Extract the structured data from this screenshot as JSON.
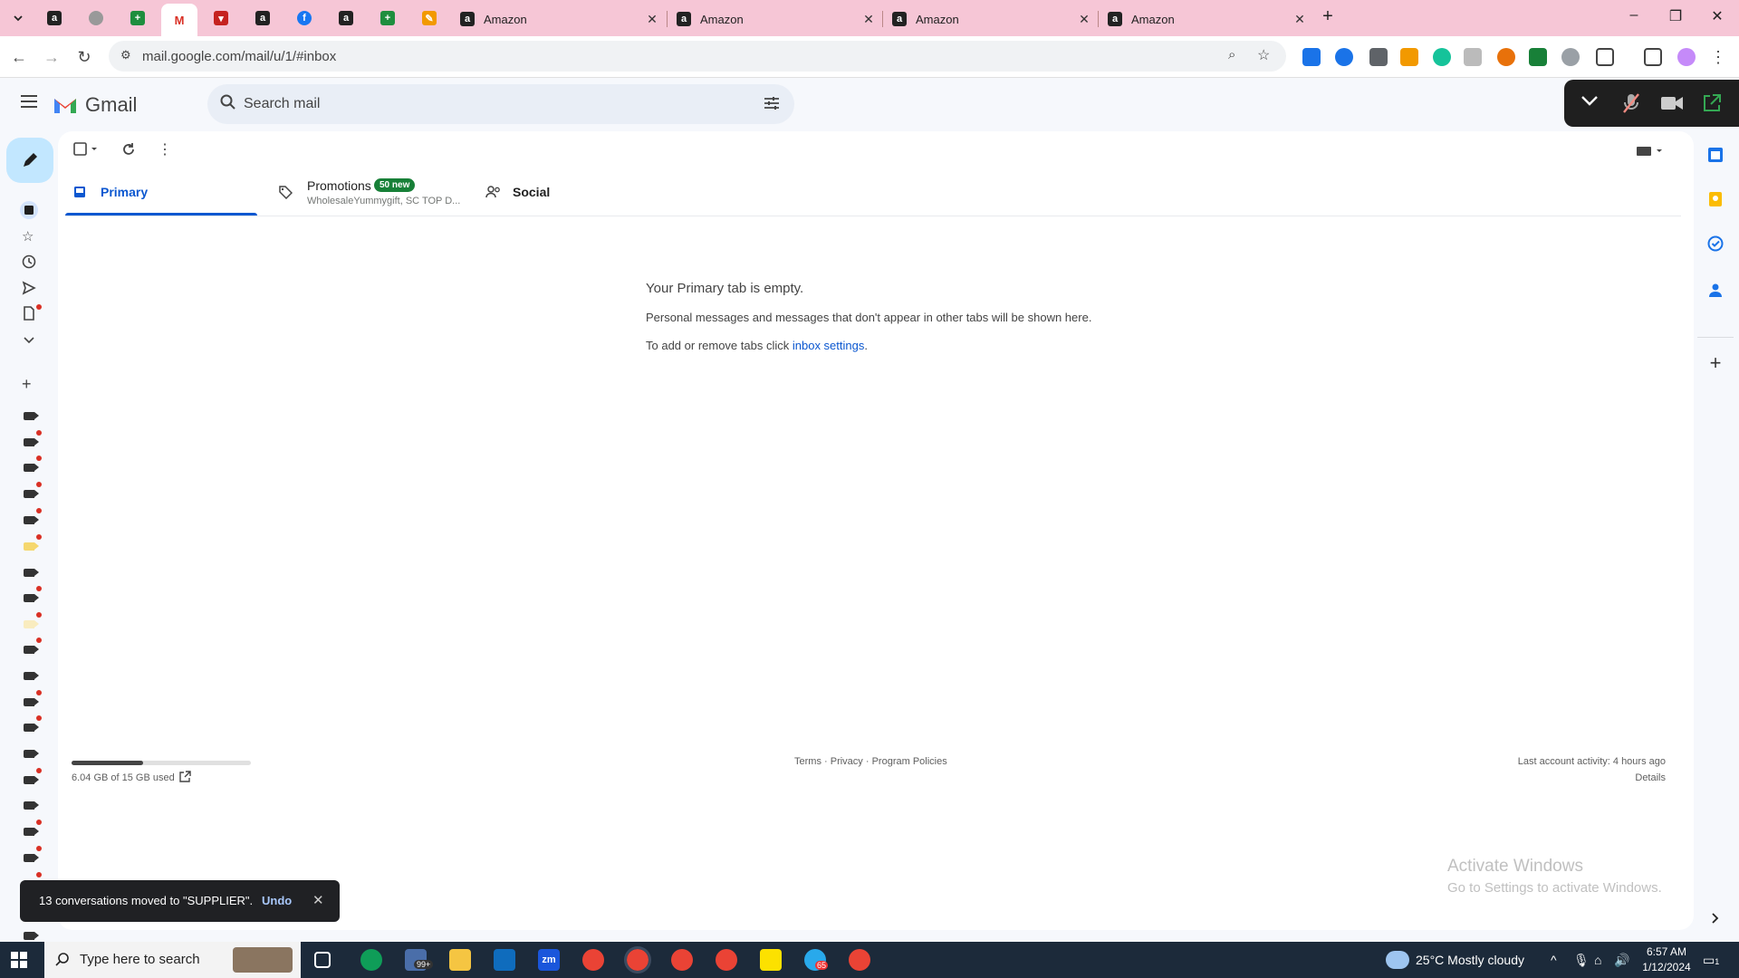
{
  "browser": {
    "tabs": [
      {
        "title": "Amazon"
      },
      {
        "title": "Amazon"
      },
      {
        "title": "Amazon"
      },
      {
        "title": "Amazon"
      }
    ],
    "url": "mail.google.com/mail/u/1/#inbox",
    "tab_strip_color": "#f6c6d6"
  },
  "gmail": {
    "logo_text": "Gmail",
    "search_placeholder": "Search mail",
    "tabs": {
      "primary": "Primary",
      "promotions": "Promotions",
      "promotions_badge": "50 new",
      "promotions_snippet": "WholesaleYummygift, SC TOP D...",
      "social": "Social"
    },
    "empty": {
      "title": "Your Primary tab is empty.",
      "desc": "Personal messages and messages that don't appear in other tabs will be shown here.",
      "settings_prefix": "To add or remove tabs click ",
      "settings_link": "inbox settings",
      "settings_suffix": "."
    },
    "footer": {
      "storage_text": "6.04 GB of 15 GB used",
      "storage_fraction": 0.4,
      "terms": "Terms",
      "privacy": "Privacy",
      "policies": "Program Policies",
      "sep": " · ",
      "activity": "Last account activity: 4 hours ago",
      "details": "Details"
    },
    "snackbar": {
      "message": "13 conversations moved to \"SUPPLIER\".",
      "undo": "Undo"
    },
    "accent": "#0b57d0"
  },
  "watermark": {
    "line1": "Activate Windows",
    "line2": "Go to Settings to activate Windows."
  },
  "taskbar": {
    "search_placeholder": "Type here to search",
    "mail_badge": "99+",
    "weather": "25°C  Mostly cloudy",
    "time": "6:57 AM",
    "date": "1/12/2024",
    "telegram_badge": "65",
    "notification_count": "1"
  }
}
